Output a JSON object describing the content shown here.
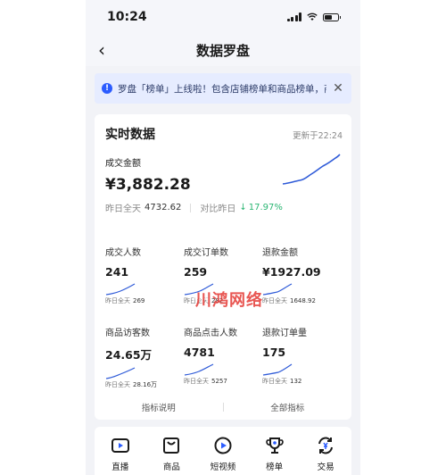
{
  "status_bar": {
    "time": "10:24"
  },
  "header": {
    "title": "数据罗盘"
  },
  "notice": {
    "text": "罗盘「榜单」上线啦！包含店铺榜单和商品榜单，商"
  },
  "realtime": {
    "title": "实时数据",
    "updated": "更新于22:24",
    "amount_label": "成交金额",
    "amount_value": "¥3,882.28",
    "yesterday_label": "昨日全天",
    "yesterday_value": "4732.62",
    "compare_label": "对比昨日",
    "compare_value": "17.97%"
  },
  "metrics": [
    {
      "label": "成交人数",
      "value": "241",
      "y_label": "昨日全天",
      "y_value": "269"
    },
    {
      "label": "成交订单数",
      "value": "259",
      "y_label": "昨日全天",
      "y_value": "282"
    },
    {
      "label": "退款金额",
      "value": "¥1927.09",
      "y_label": "昨日全天",
      "y_value": "1648.92"
    },
    {
      "label": "商品访客数",
      "value": "24.65万",
      "y_label": "昨日全天",
      "y_value": "28.16万"
    },
    {
      "label": "商品点击人数",
      "value": "4781",
      "y_label": "昨日全天",
      "y_value": "5257"
    },
    {
      "label": "退款订单量",
      "value": "175",
      "y_label": "昨日全天",
      "y_value": "132"
    }
  ],
  "footer": {
    "left": "指标说明",
    "right": "全部指标"
  },
  "watermark": {
    "text": "川鸿网络",
    "small": "川鸿"
  },
  "tabs": [
    {
      "label": "直播",
      "icon": "live-video-icon"
    },
    {
      "label": "商品",
      "icon": "product-box-icon"
    },
    {
      "label": "短视频",
      "icon": "play-circle-icon"
    },
    {
      "label": "榜单",
      "icon": "trophy-icon"
    },
    {
      "label": "交易",
      "icon": "exchange-yuan-icon"
    }
  ],
  "colors": {
    "accent": "#2b5cff",
    "positive": "#2bb673",
    "line": "#2f5bd8"
  }
}
